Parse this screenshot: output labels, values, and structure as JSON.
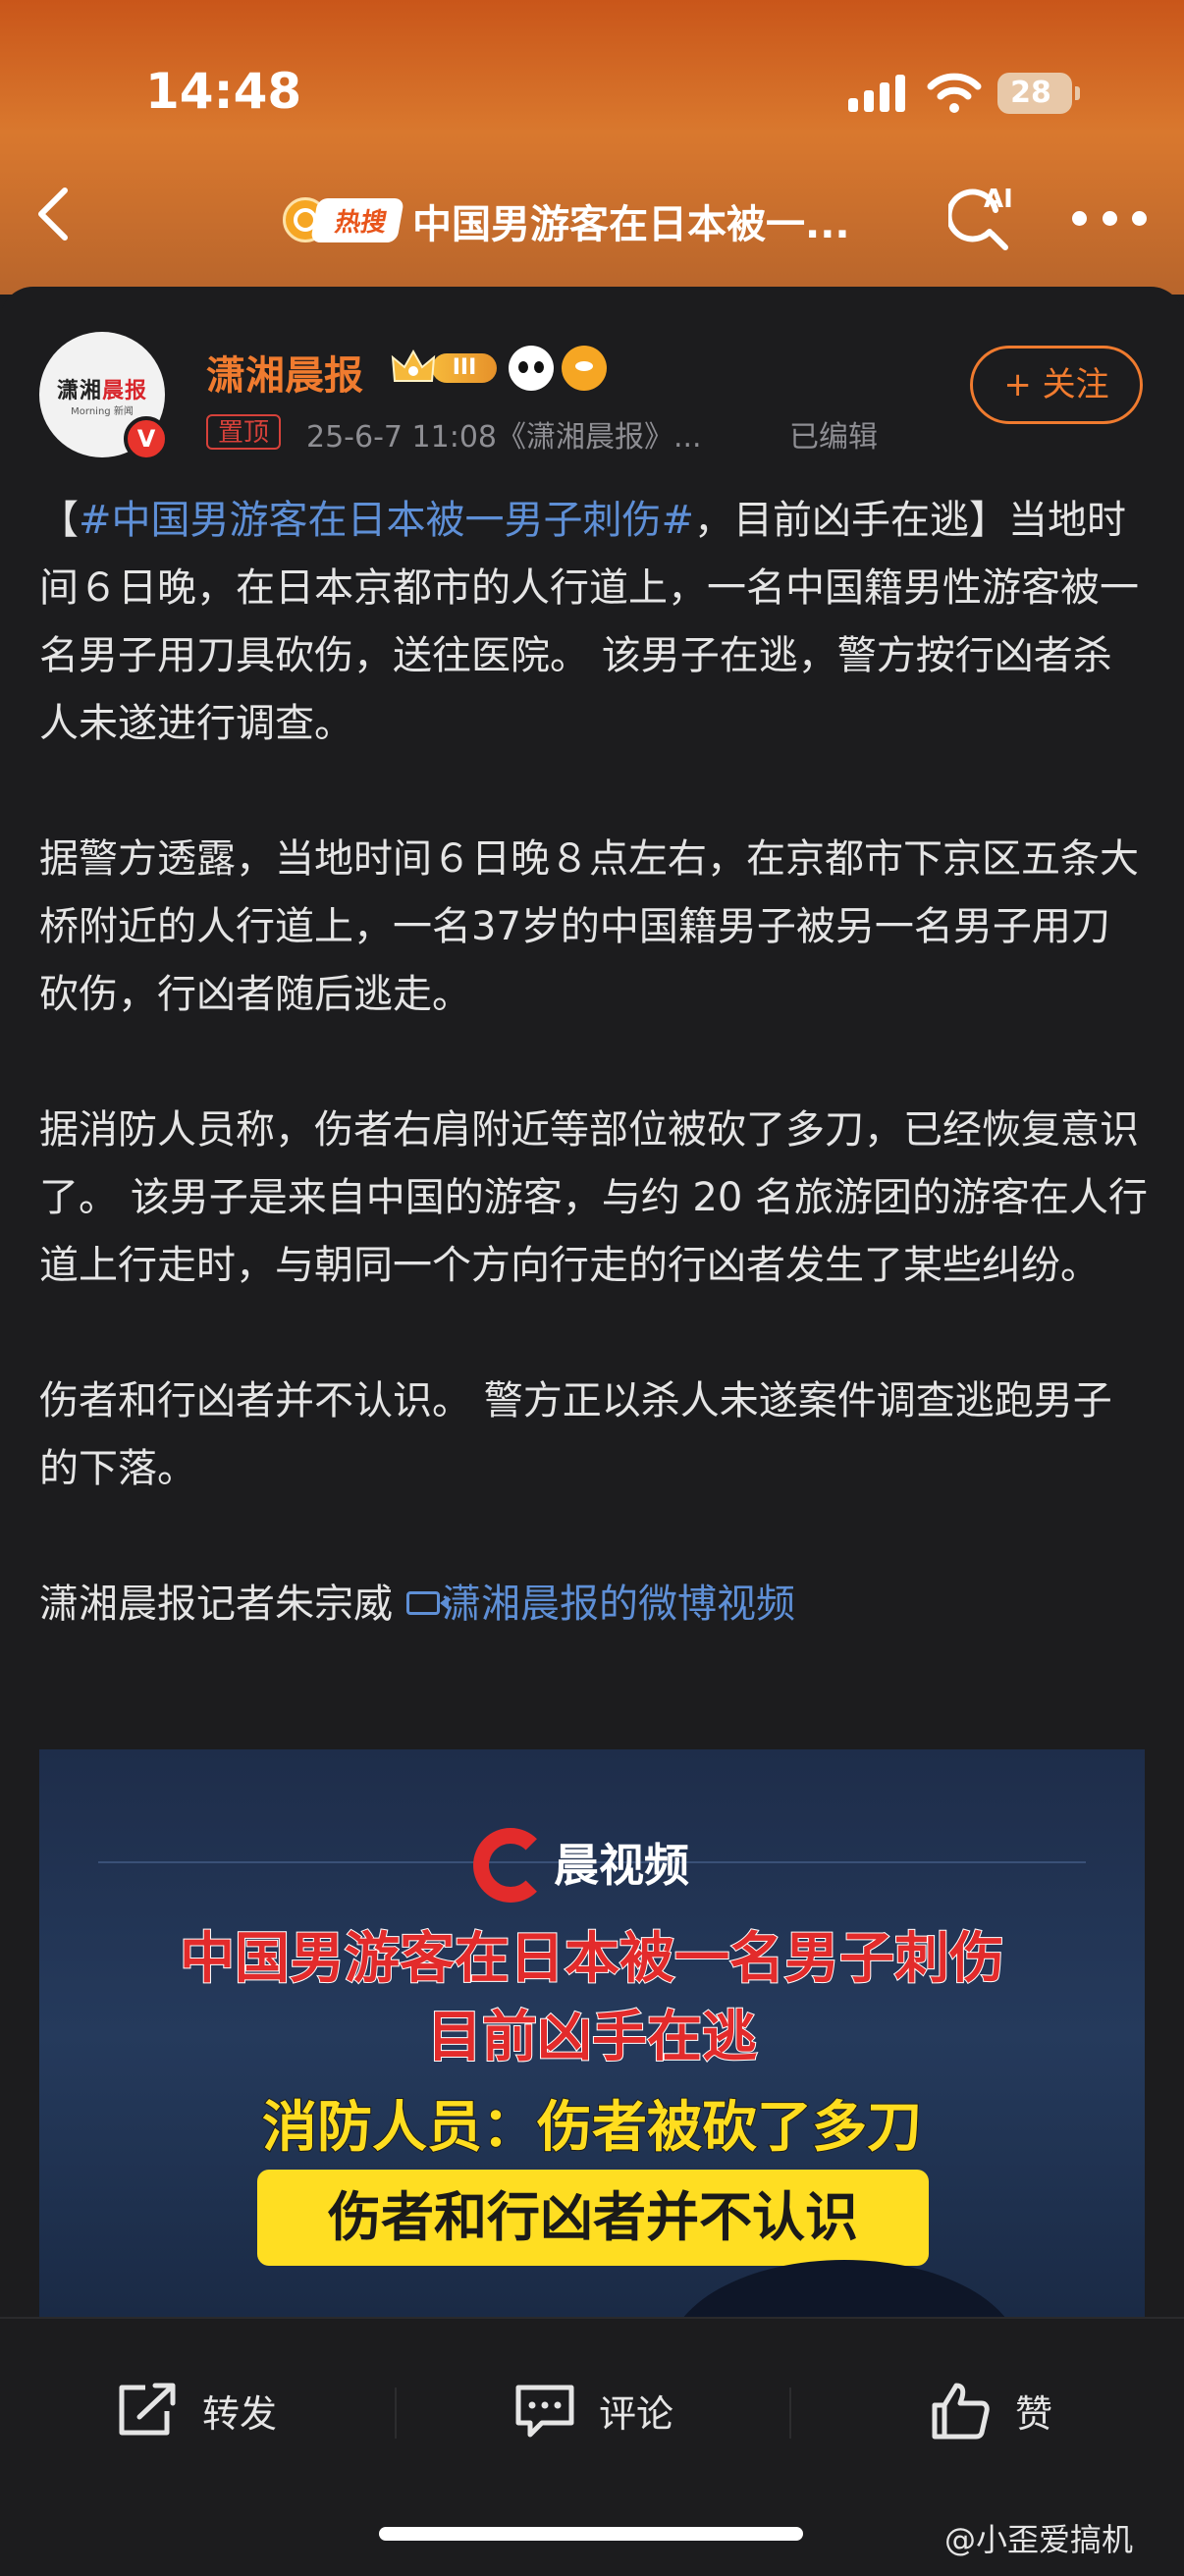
{
  "status_bar": {
    "time": "14:48",
    "battery": "28"
  },
  "nav": {
    "hot_label": "热搜",
    "title": "中国男游客在日本被一...",
    "ai_label": "AI"
  },
  "post": {
    "author": "潇湘晨报",
    "avatar_text_1": "潇湘",
    "avatar_text_2": "晨报",
    "avatar_subtext": "Morning 新闻",
    "verified_mark": "V",
    "level_badge": "III",
    "pinned_label": "置顶",
    "meta": "25-6-7 11:08《潇湘晨报》...",
    "edited_label": "已编辑",
    "follow_label": "+ 关注",
    "p1_open": "【",
    "p1_hashtag": "#中国男游客在日本被一男子刺伤#",
    "p1_rest": "，目前凶手在逃】当地时间６日晚，在日本京都市的人行道上，一名中国籍男性游客被一名男子用刀具砍伤，送往医院。 该男子在逃，警方按行凶者杀人未遂进行调查。",
    "p2": "据警方透露，当地时间６日晚８点左右，在京都市下京区五条大桥附近的人行道上，一名37岁的中国籍男子被另一名男子用刀砍伤，行凶者随后逃走。",
    "p3": "据消防人员称，伤者右肩附近等部位被砍了多刀，已经恢复意识了。 该男子是来自中国的游客，与约 20 名旅游团的游客在人行道上行走时，与朝同一个方向行走的行凶者发生了某些纠纷。",
    "p4": "伤者和行凶者并不认识。 警方正以杀人未遂案件调查逃跑男子的下落。",
    "p5_text": "潇湘晨报记者朱宗威",
    "p5_link": "潇湘晨报的微博视频"
  },
  "video": {
    "brand": "晨视频",
    "headline_1": "中国男游客在日本被一名男子刺伤",
    "headline_2": "目前凶手在逃",
    "subhead": "消防人员：伤者被砍了多刀",
    "banner": "伤者和行凶者并不认识"
  },
  "actions": {
    "repost": "转发",
    "comment": "评论",
    "like": "赞"
  },
  "watermark": "@小歪爱搞机",
  "colors": {
    "accent": "#f07b2f",
    "link": "#5e8fd6",
    "header": "#c9561a"
  }
}
